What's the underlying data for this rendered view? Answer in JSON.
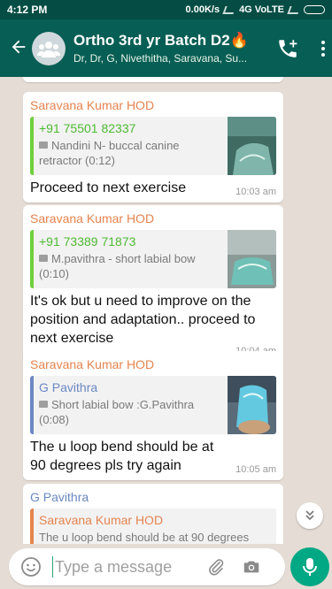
{
  "status": {
    "time": "4:12 PM",
    "speed": "0.00K/s",
    "network": "4G VoLTE"
  },
  "header": {
    "title": "Ortho 3rd yr Batch D2🔥",
    "subtitle": "Dr, Dr, G, Nivethitha, Saravana, Su..."
  },
  "messages": [
    {
      "sender": "Saravana Kumar HOD",
      "quote_name": "+91 75501 82337",
      "quote_text": "Nandini N- buccal canine retractor (0:12)",
      "text": "Proceed to next exercise",
      "time": "10:03 am"
    },
    {
      "sender": "Saravana Kumar HOD",
      "quote_name": "+91 73389 71873",
      "quote_text": "M.pavithra - short labial bow (0:10)",
      "text": "It's ok but u need to improve on the position and adaptation.. proceed to next exercise",
      "time": "10:04 am"
    },
    {
      "sender": "Saravana Kumar HOD",
      "quote_name": "G Pavithra",
      "quote_text": "Short labial bow :G.Pavithra (0:08)",
      "text": "The u loop bend should be at 90 degrees pls try again",
      "time": "10:05 am"
    },
    {
      "sender": "G Pavithra",
      "quote_name": "Saravana Kumar HOD",
      "quote_text": "The u loop bend should be at 90 degrees"
    }
  ],
  "input": {
    "placeholder": "Type a message"
  },
  "colors": {
    "header": "#075e54",
    "statusbar": "#054d44",
    "accent": "#00a884",
    "chat_bg": "#e5ddd5"
  }
}
